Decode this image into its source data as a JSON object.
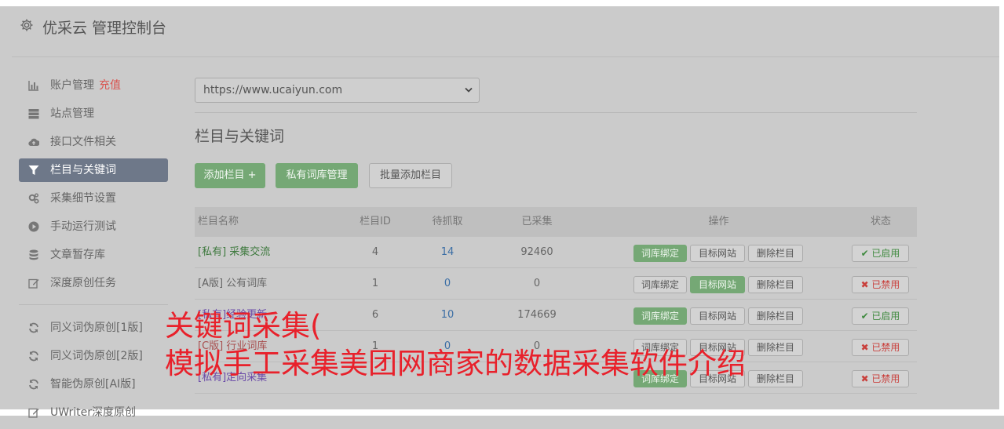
{
  "header": {
    "title": "优采云 管理控制台",
    "icon": "gear-icon"
  },
  "sidebar": {
    "items": [
      {
        "label": "账户管理",
        "extra": "充值",
        "icon": "bar-chart-icon"
      },
      {
        "label": "站点管理",
        "icon": "server-icon"
      },
      {
        "label": "接口文件相关",
        "icon": "cloud-upload-icon"
      },
      {
        "label": "栏目与关键词",
        "icon": "filter-icon",
        "active": true
      },
      {
        "label": "采集细节设置",
        "icon": "cogs-icon"
      },
      {
        "label": "手动运行测试",
        "icon": "play-circle-icon"
      },
      {
        "label": "文章暂存库",
        "icon": "database-icon"
      },
      {
        "label": "深度原创任务",
        "icon": "edit-icon"
      }
    ],
    "items2": [
      {
        "label": "同义词伪原创[1版]",
        "icon": "refresh-icon"
      },
      {
        "label": "同义词伪原创[2版]",
        "icon": "refresh-icon"
      },
      {
        "label": "智能伪原创[AI版]",
        "icon": "refresh-icon"
      },
      {
        "label": "UWriter深度原创",
        "icon": "edit-icon"
      }
    ]
  },
  "main": {
    "site_select": {
      "value": "https://www.ucaiyun.com"
    },
    "section_title": "栏目与关键词",
    "buttons": {
      "add_column": "添加栏目 +",
      "private_lib": "私有词库管理",
      "batch_add": "批量添加栏目"
    },
    "table": {
      "headers": {
        "name": "栏目名称",
        "id": "栏目ID",
        "pending": "待抓取",
        "collected": "已采集",
        "ops": "操作",
        "status": "状态"
      },
      "rows": [
        {
          "name": "[私有] 采集交流",
          "id": "4",
          "pending": "14",
          "collected": "92460",
          "op1": "词库绑定",
          "op2": "目标网站",
          "op3": "删除栏目",
          "status": "✔ 已启用"
        },
        {
          "name": "[A版] 公有词库",
          "id": "1",
          "pending": "0",
          "collected": "0",
          "op1": "词库绑定",
          "op2": "目标网站",
          "op3": "删除栏目",
          "status": "✖ 已禁用"
        },
        {
          "name": "[私有]经验更新",
          "id": "6",
          "pending": "10",
          "collected": "174669",
          "op1": "词库绑定",
          "op2": "目标网站",
          "op3": "删除栏目",
          "status": "✔ 已启用"
        },
        {
          "name": "[C版] 行业词库",
          "id": "1",
          "pending": "0",
          "collected": "0",
          "op1": "词库绑定",
          "op2": "目标网站",
          "op3": "删除栏目",
          "status": "✖ 已禁用"
        },
        {
          "name": "[私有]定向采集",
          "id": "",
          "pending": "",
          "collected": "",
          "op1": "词库绑定",
          "op2": "目标网站",
          "op3": "删除栏目",
          "status": "✖ 已禁用"
        }
      ]
    }
  },
  "overlay": {
    "line1": "关键词采集(",
    "line2": "模拟手工采集美团网商家的数据采集软件介绍"
  }
}
